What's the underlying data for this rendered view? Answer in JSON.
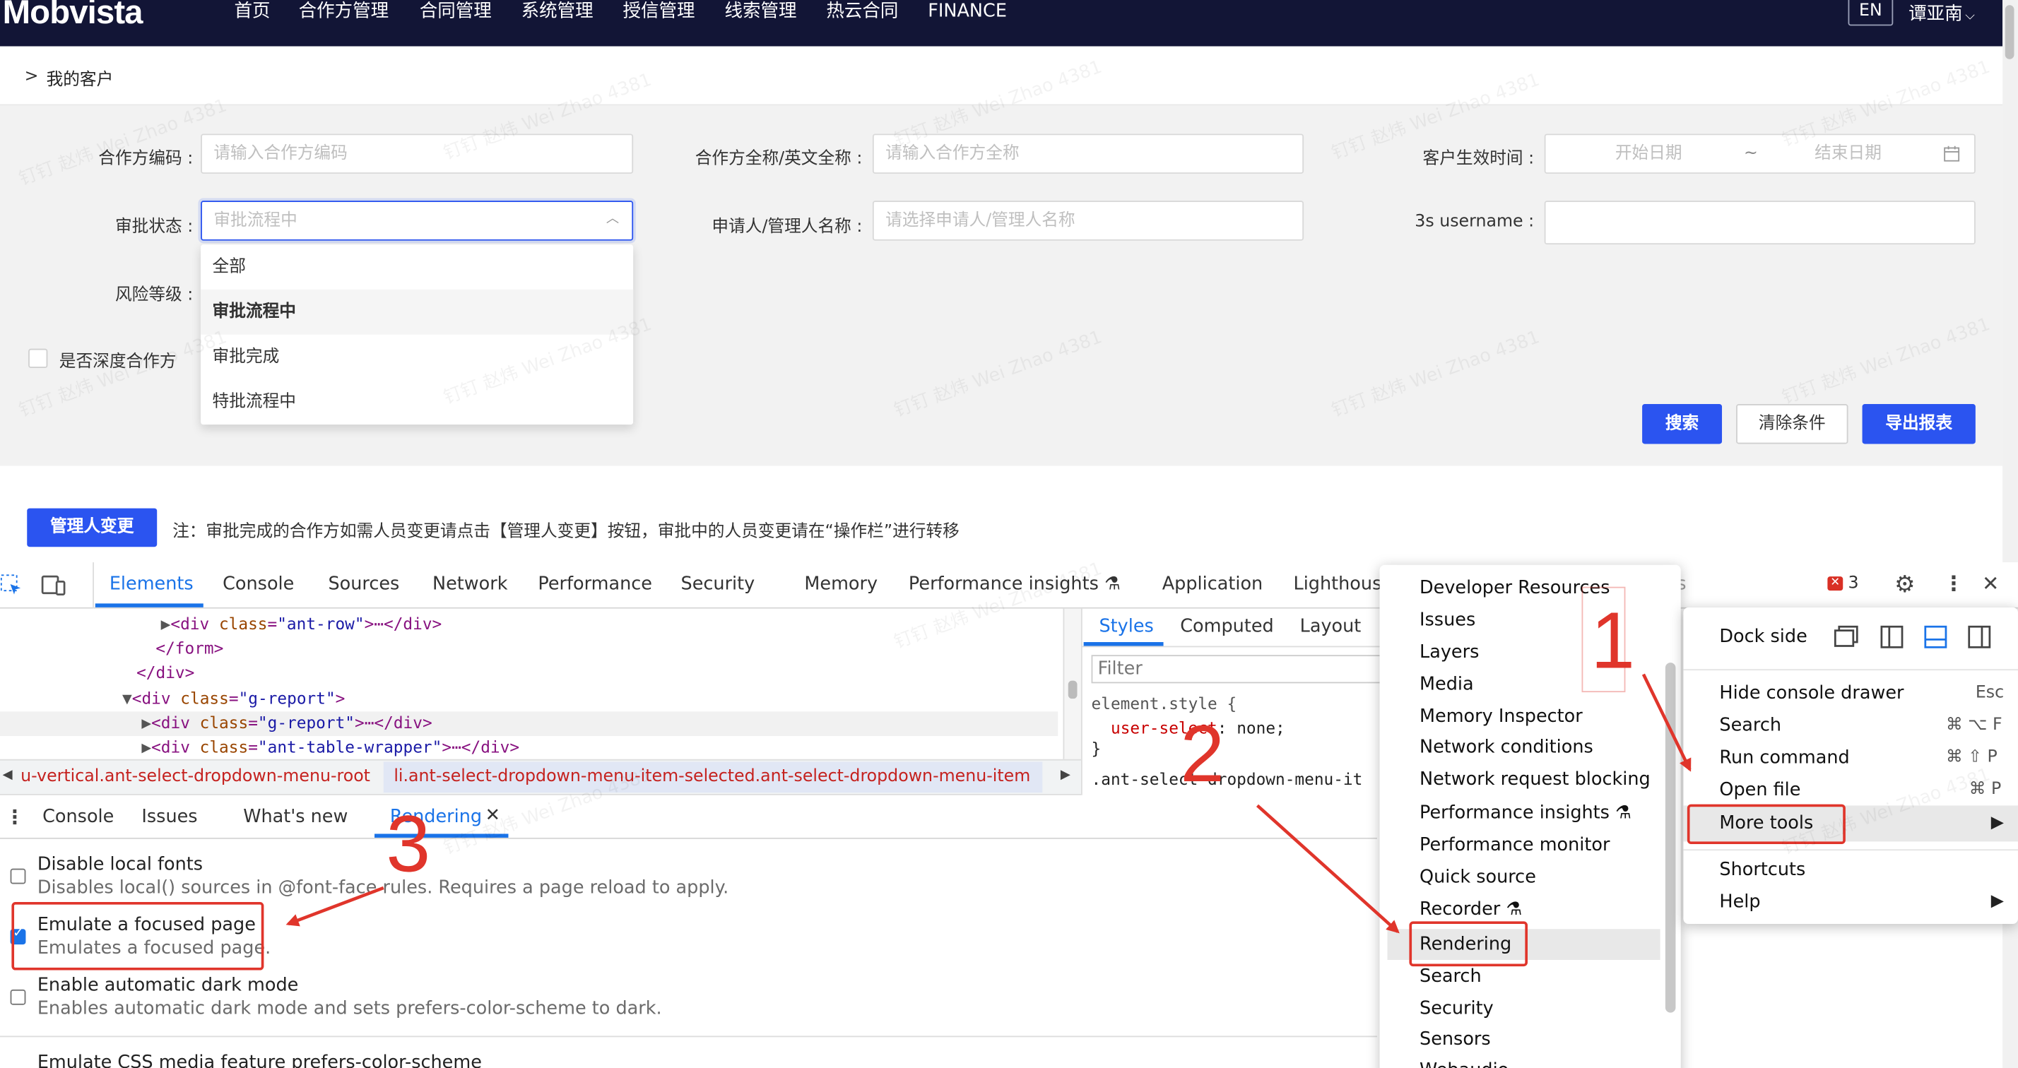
{
  "topnav": {
    "logo": "Mobvista",
    "items": [
      "首页",
      "合作方管理",
      "合同管理",
      "系统管理",
      "授信管理",
      "线索管理",
      "热云合同",
      "FINANCE"
    ],
    "lang": "EN",
    "user": "谭亚南"
  },
  "breadcrumb": {
    "arrow": ">",
    "title": "我的客户"
  },
  "filters": {
    "partner_code_label": "合作方编码 :",
    "partner_code_placeholder": "请输入合作方编码",
    "partner_name_label": "合作方全称/英文全称 :",
    "partner_name_placeholder": "请输入合作方全称",
    "effective_time_label": "客户生效时间 :",
    "start_date": "开始日期",
    "tilde": "~",
    "end_date": "结束日期",
    "status_label": "审批状态 :",
    "status_placeholder": "审批流程中",
    "applicant_label": "申请人/管理人名称 :",
    "applicant_placeholder": "请选择申请人/管理人名称",
    "username_label": "3s username :",
    "risk_label": "风险等级 :",
    "deep_partner_label": "是否深度合作方",
    "status_options": [
      "全部",
      "审批流程中",
      "审批完成",
      "特批流程中"
    ],
    "search_btn": "搜索",
    "clear_btn": "清除条件",
    "export_btn": "导出报表"
  },
  "action_bar": {
    "change_manager_btn": "管理人变更",
    "note": "注：审批完成的合作方如需人员变更请点击【管理人变更】按钮，审批中的人员变更请在“操作栏”进行转移"
  },
  "devtools": {
    "tabs": [
      "Elements",
      "Console",
      "Sources",
      "Network",
      "Performance",
      "Security",
      "Memory",
      "Performance insights",
      "Application",
      "Lighthous"
    ],
    "issues_count": "3",
    "elements_lines": [
      {
        "indent": 1,
        "open": "<div ",
        "attr": "class",
        "val": "\"ant-row\"",
        "tail": ">⋯</div>"
      },
      {
        "indent": 2,
        "plain": "</form>"
      },
      {
        "indent": 3,
        "plain": "</div>"
      },
      {
        "indent": 4,
        "open": "<div ",
        "attr": "class",
        "val": "\"g-report\"",
        "tail": ">"
      },
      {
        "indent": 5,
        "open": "<div ",
        "attr": "class",
        "val": "\"g-report\"",
        "tail": ">⋯</div>"
      },
      {
        "indent": 5,
        "open": "<div ",
        "attr": "class",
        "val": "\"ant-table-wrapper\"",
        "tail": ">⋯</div>"
      }
    ],
    "styles_tabs": [
      "Styles",
      "Computed",
      "Layout"
    ],
    "styles_filter": "Filter",
    "styles_code": [
      "element.style {",
      "  user-select: none;",
      "}",
      ".ant-select-dropdown-menu-it"
    ],
    "path": [
      "u-vertical.ant-select-dropdown-menu-root",
      "li.ant-select-dropdown-menu-item-selected.ant-select-dropdown-menu-item"
    ],
    "drawer_tabs": [
      "Console",
      "Issues",
      "What's new",
      "Rendering"
    ],
    "rendering_options": [
      {
        "title": "Disable local fonts",
        "desc": "Disables local() sources in @font-face rules. Requires a page reload to apply.",
        "checked": false
      },
      {
        "title": "Emulate a focused page",
        "desc": "Emulates a focused page.",
        "checked": true
      },
      {
        "title": "Enable automatic dark mode",
        "desc": "Enables automatic dark mode and sets prefers-color-scheme to dark.",
        "checked": false
      },
      {
        "title": "Emulate CSS media feature prefers-color-scheme",
        "desc": "",
        "checked": false
      }
    ]
  },
  "more_tools_menu": [
    "Developer Resources",
    "Issues",
    "Layers",
    "Media",
    "Memory Inspector",
    "Network conditions",
    "Network request blocking",
    "Performance insights",
    "Performance monitor",
    "Quick source",
    "Recorder",
    "Rendering",
    "Search",
    "Security",
    "Sensors",
    "Webaudio"
  ],
  "main_menu": {
    "dock_side": "Dock side",
    "items": [
      {
        "label": "Hide console drawer",
        "shortcut": "Esc"
      },
      {
        "label": "Search",
        "shortcut": "⌘ ⌥ F"
      },
      {
        "label": "Run command",
        "shortcut": "⌘ ⇧ P"
      },
      {
        "label": "Open file",
        "shortcut": "⌘ P"
      },
      {
        "label": "More tools",
        "shortcut": "▶"
      },
      {
        "label": "Shortcuts",
        "shortcut": ""
      },
      {
        "label": "Help",
        "shortcut": "▶"
      }
    ]
  },
  "annotations": {
    "n1": "1",
    "n2": "2",
    "n3": "3",
    "color": "#e0352b"
  },
  "watermark": "钉钉 赵炜 Wei Zhao 4381",
  "colors": {
    "nav": "#121536",
    "primary": "#2b54f0",
    "devtools_active": "#1a73e8"
  }
}
